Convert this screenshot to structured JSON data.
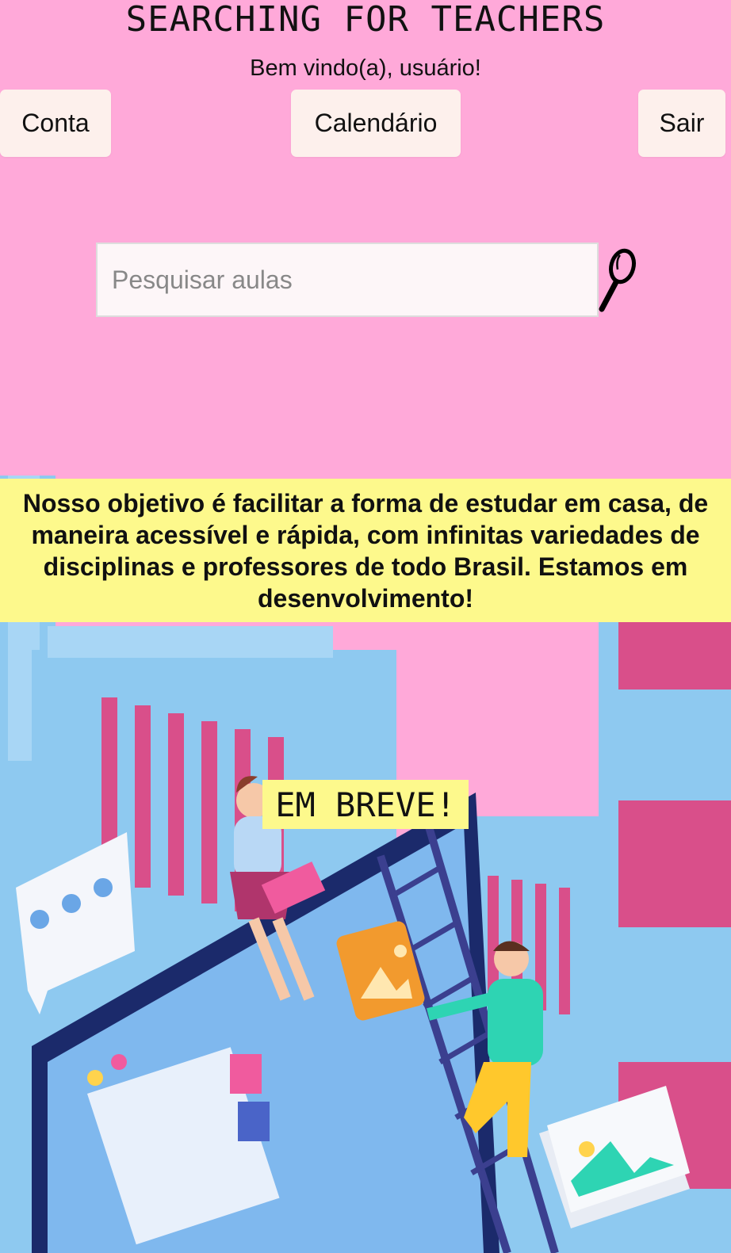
{
  "header": {
    "title": "SEARCHING FOR TEACHERS",
    "welcome": "Bem vindo(a), usuário!"
  },
  "nav": {
    "account_label": "Conta",
    "calendar_label": "Calendário",
    "logout_label": "Sair"
  },
  "search": {
    "placeholder": "Pesquisar aulas",
    "value": "",
    "icon": "magnifier-icon"
  },
  "mission": {
    "text": "Nosso objetivo é facilitar a forma de estudar em casa, de maneira acessível e rápida, com infinitas variedades de disciplinas e professores de todo Brasil. Estamos em desenvolvimento!"
  },
  "banner": {
    "soon_label": "EM BREVE!"
  },
  "colors": {
    "page_background": "#ffa9d9",
    "button_background": "#fdf0ec",
    "highlight_yellow": "#fdf98c",
    "illustration_blue": "#8ec9f0"
  }
}
